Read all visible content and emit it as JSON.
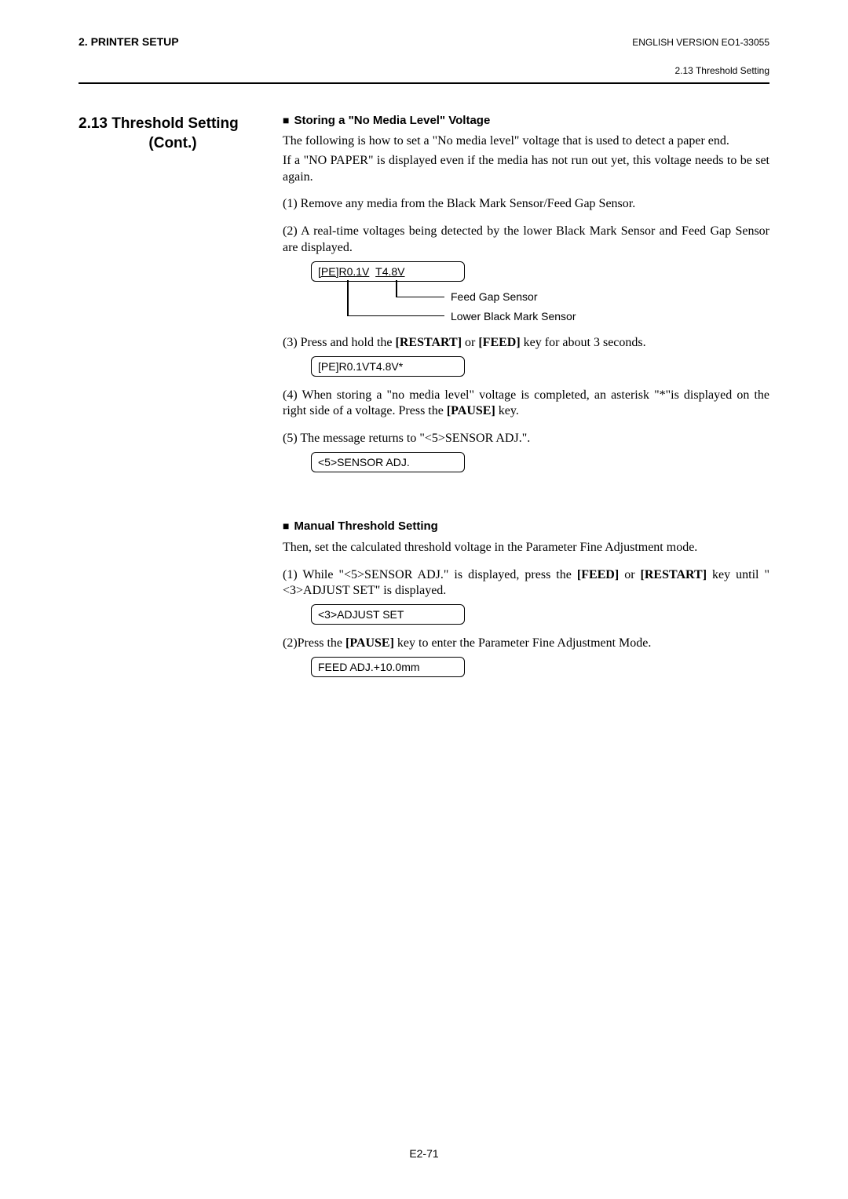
{
  "header": {
    "left": "2. PRINTER SETUP",
    "right": "ENGLISH VERSION EO1-33055",
    "sub": "2.13 Threshold Setting"
  },
  "section": {
    "number": "2.13",
    "title": "Threshold Setting",
    "cont": "(Cont.)"
  },
  "storing": {
    "heading": "Storing a \"No Media Level\" Voltage",
    "intro1": "The following is how to set a \"No media level\" voltage that is used to detect a paper end.",
    "intro2": "If a \"NO PAPER\" is displayed even if the media has not run out yet, this voltage needs to be set again.",
    "step1": "(1) Remove any media from the Black Mark Sensor/Feed Gap Sensor.",
    "step2": "(2) A real-time voltages being detected by the lower Black Mark Sensor and Feed Gap Sensor are displayed.",
    "diagram": {
      "box_part1": "[PE]R0.1V",
      "box_part2": "T4.8V",
      "label1": "Feed Gap Sensor",
      "label2": "Lower Black Mark Sensor"
    },
    "step3_pre": "(3) Press and hold the ",
    "step3_key1": "[RESTART]",
    "step3_mid": " or ",
    "step3_key2": "[FEED]",
    "step3_post": " key for about 3 seconds.",
    "display3": "[PE]R0.1VT4.8V*",
    "step4_pre": "(4) When storing a \"no media level\" voltage is completed, an asterisk \"*\"is displayed on the right side of a voltage.  Press the ",
    "step4_key": "[PAUSE]",
    "step4_post": " key.",
    "step5": "(5) The message returns to \"<5>SENSOR ADJ.\".",
    "display5": "<5>SENSOR ADJ."
  },
  "manual": {
    "heading": "Manual Threshold Setting",
    "intro": "Then, set the calculated threshold voltage in the Parameter Fine Adjustment mode.",
    "step1_pre": "(1) While \"<5>SENSOR ADJ.\" is displayed, press the ",
    "step1_key1": "[FEED]",
    "step1_mid": " or ",
    "step1_key2": "[RESTART]",
    "step1_post": " key until \"<3>ADJUST SET\" is displayed.",
    "display1": "<3>ADJUST SET",
    "step2_pre": "(2)Press the ",
    "step2_key": "[PAUSE]",
    "step2_post": " key to enter the Parameter Fine Adjustment Mode.",
    "display2": "FEED ADJ.+10.0mm"
  },
  "footer": {
    "page": "E2-71"
  }
}
